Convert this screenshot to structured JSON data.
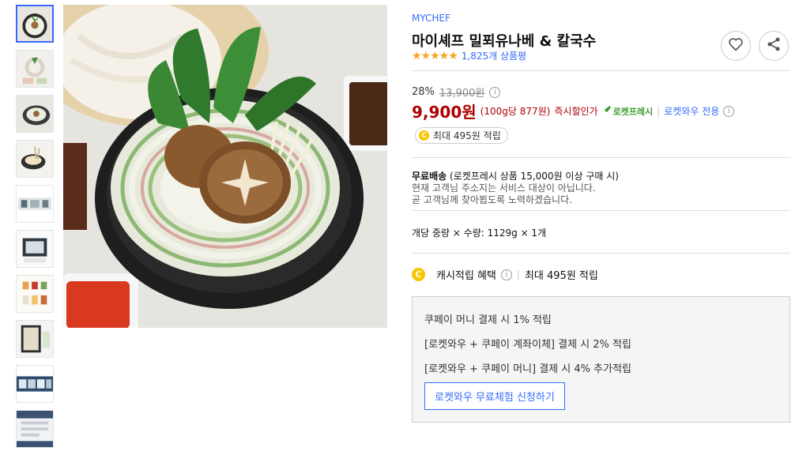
{
  "product": {
    "brand": "MYCHEF",
    "title": "마이셰프 밀푀유나베 & 칼국수",
    "stars": "★★★★★",
    "review_count": "1,825개 상품평"
  },
  "actions": {
    "wishlist_icon": "heart-icon",
    "share_icon": "share-icon"
  },
  "pricing": {
    "discount_rate": "28%",
    "original_price": "13,900원",
    "sale_price": "9,900원",
    "unit_price": "(100g당 877원)",
    "instant_label": "즉시할인가",
    "rocket_fresh": "로켓프레시",
    "separator": "|",
    "wow_only": "로켓와우 전용",
    "info": "i"
  },
  "cash_badge": {
    "coin": "C",
    "text": "최대 495원 적립"
  },
  "shipping": {
    "free_label": "무료배송",
    "free_detail": " (로켓프레시 상품 15,000원 이상 구매 시)",
    "not_available": "현재 고객님 주소지는 서비스 대상이 아닙니다.",
    "soon": "곧 고객님께 찾아뵙도록 노력하겠습니다."
  },
  "weight": "개당 중량 × 수량: 1129g × 1개",
  "cashback": {
    "coin": "C",
    "label": "캐시적립 혜택",
    "max": "최대 495원 적립",
    "lines": [
      "쿠페이 머니 결제 시 1% 적립",
      "[로켓와우 + 쿠페이 계좌이체] 결제 시 2% 적립",
      "[로켓와우 + 쿠페이 머니] 결제 시 4% 추가적립"
    ],
    "trial_button": "로켓와우 무료체험 신청하기"
  },
  "colors": {
    "accent": "#346aff",
    "price": "#ae0000",
    "rocket_green": "#3c9e2e",
    "star": "#f5a623",
    "coin": "#f7c600"
  },
  "gallery": {
    "thumbnail_count": 10,
    "selected_index": 0
  }
}
